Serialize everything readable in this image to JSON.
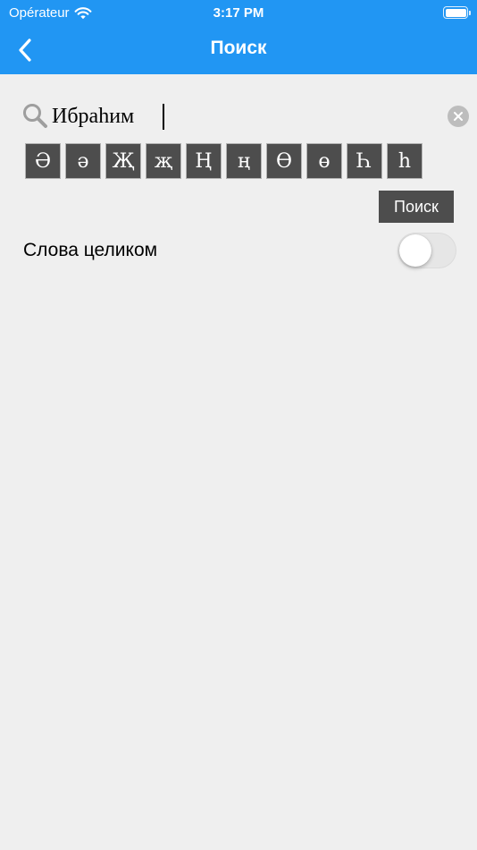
{
  "status_bar": {
    "carrier": "Opérateur",
    "time": "3:17 PM"
  },
  "nav": {
    "title": "Поиск",
    "back_icon": "chevron-left-icon"
  },
  "search": {
    "value": "Ибраһим",
    "icon": "search-icon",
    "clear_icon": "close-icon"
  },
  "special_keys": [
    "Ә",
    "ә",
    "Җ",
    "җ",
    "Ң",
    "ң",
    "Ө",
    "ө",
    "Һ",
    "һ"
  ],
  "search_button_label": "Поиск",
  "options": {
    "whole_words_label": "Слова целиком",
    "whole_words_enabled": false
  },
  "colors": {
    "accent": "#2196f3",
    "key_background": "#4d4d4d",
    "page_background": "#efefef"
  }
}
